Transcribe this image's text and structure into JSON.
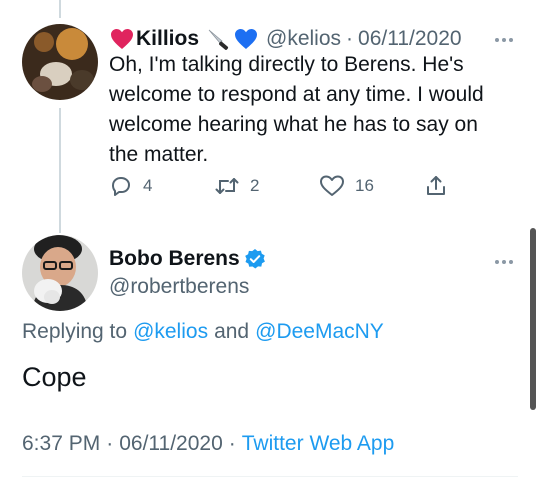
{
  "prev_tweet": {
    "display_name": "Killios",
    "handle": "@kelios",
    "separator": "·",
    "date": "06/11/2020",
    "text": "Oh, I'm talking directly to Berens. He's welcome to respond at any time. I would welcome hearing what he has to say on the matter.",
    "name_emoji": [
      "red-heart-icon",
      "knife-icon",
      "blue-heart-icon"
    ],
    "actions": {
      "replies": "4",
      "retweets": "2",
      "likes": "16"
    }
  },
  "main_tweet": {
    "display_name": "Bobo Berens",
    "handle": "@robertberens",
    "verified": true,
    "replying_prefix": "Replying to",
    "replying_user1": "@kelios",
    "replying_and": "and",
    "replying_user2": "@DeeMacNY",
    "text": "Cope",
    "time": "6:37 PM",
    "separator": "·",
    "date": "06/11/2020",
    "source_separator": "·",
    "source": "Twitter Web App"
  },
  "colors": {
    "link": "#1d9bf0",
    "muted": "#536471",
    "text": "#0f1419",
    "heart_red": "#e0245e",
    "heart_blue": "#1d6ff2"
  }
}
